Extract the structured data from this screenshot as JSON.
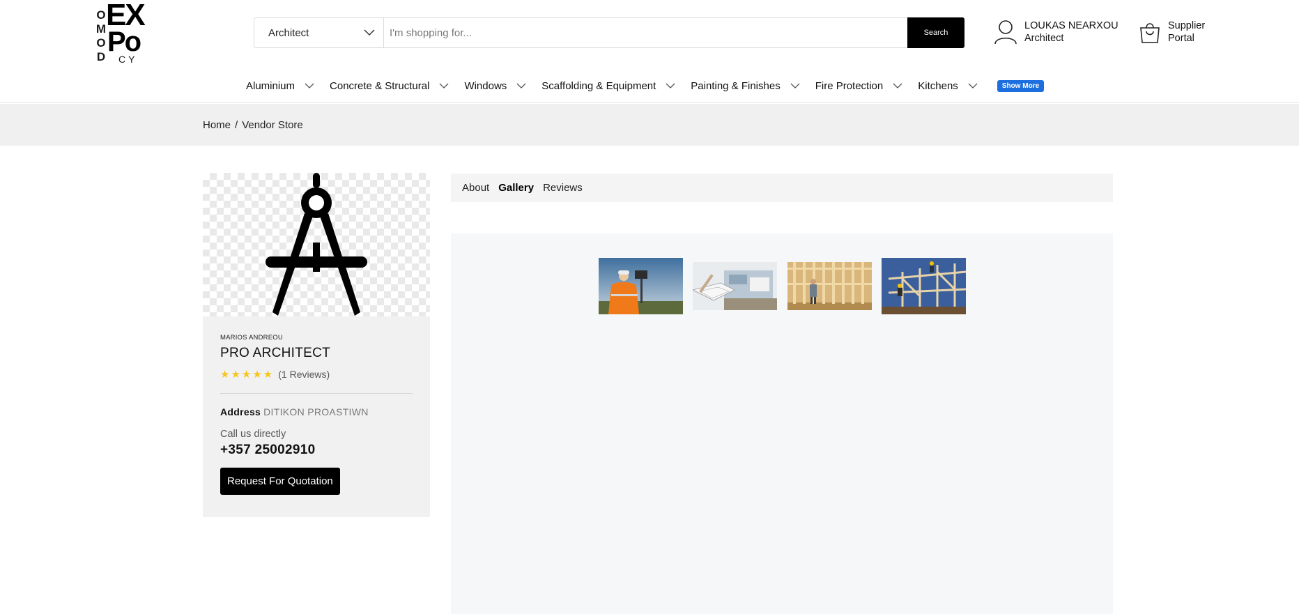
{
  "logo": {
    "alt": "Domo Expo CY",
    "vertical_letters": [
      "O",
      "M",
      "O",
      "D"
    ],
    "line1": "EX",
    "line2": "Po",
    "line3": "CY"
  },
  "search": {
    "category": "Architect",
    "placeholder": "I'm shopping for...",
    "button_label": "Search"
  },
  "account": {
    "name": "LOUKAS NEARXOU",
    "role": "Architect"
  },
  "portal": {
    "line1": "Supplier",
    "line2": "Portal"
  },
  "nav": {
    "items": [
      {
        "label": "Aluminium"
      },
      {
        "label": "Concrete & Structural"
      },
      {
        "label": "Windows"
      },
      {
        "label": "Scaffolding & Equipment"
      },
      {
        "label": "Painting & Finishes"
      },
      {
        "label": "Fire Protection"
      },
      {
        "label": "Kitchens"
      }
    ],
    "show_more": "Show More"
  },
  "breadcrumb": {
    "home": "Home",
    "separator": "/",
    "current": "Vendor Store"
  },
  "vendor": {
    "owner": "MARIOS ANDREOU",
    "name": "PRO ARCHITECT",
    "stars": "★★★★★",
    "rating_value": 5,
    "reviews": "(1 Reviews)",
    "address_label": "Address",
    "address": "DITIKON PROASTIWN",
    "call_label": "Call us directly",
    "phone": "+357 25002910",
    "rfq_button": "Request For Quotation"
  },
  "tabs": [
    {
      "label": "About",
      "active": false
    },
    {
      "label": "Gallery",
      "active": true
    },
    {
      "label": "Reviews",
      "active": false
    }
  ],
  "gallery": {
    "images": [
      "surveyor-photo",
      "architecture-sketch-photo",
      "timber-frame-photo",
      "roof-workers-photo"
    ]
  },
  "colors": {
    "accent": "#1d6fe0",
    "button_dark": "#000000",
    "star": "#f5c518",
    "breadcrumb_bg": "#f0f0f0"
  }
}
